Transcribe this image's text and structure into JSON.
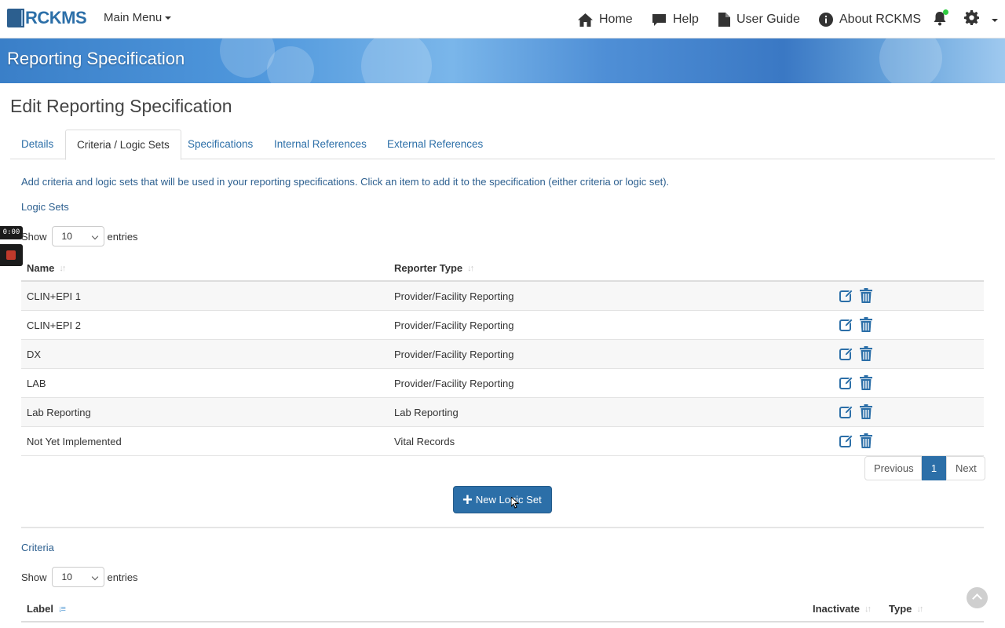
{
  "navbar": {
    "brand": "RCKMS",
    "main_menu": "Main Menu",
    "items": [
      {
        "label": "Home",
        "icon": "home-icon"
      },
      {
        "label": "Help",
        "icon": "comment-icon"
      },
      {
        "label": "User Guide",
        "icon": "document-icon"
      },
      {
        "label": "About RCKMS",
        "icon": "info-icon"
      }
    ],
    "notification_icon": "bell-icon",
    "settings_icon": "gear-icon"
  },
  "banner": {
    "title": "Reporting Specification"
  },
  "page": {
    "title": "Edit Reporting Specification"
  },
  "tabs": [
    {
      "label": "Details",
      "active": false
    },
    {
      "label": "Criteria / Logic Sets",
      "active": true
    },
    {
      "label": "Specifications",
      "active": false
    },
    {
      "label": "Internal References",
      "active": false
    },
    {
      "label": "External References",
      "active": false
    }
  ],
  "intro_text": "Add criteria and logic sets that will be used in your reporting specifications. Click an item to add it to the specification (either criteria or logic set).",
  "recorder": {
    "time": "0:00"
  },
  "logic_sets": {
    "label": "Logic Sets",
    "show_label": "Show",
    "page_size": "10",
    "entries_label": "entries",
    "columns": [
      "Name",
      "Reporter Type"
    ],
    "rows": [
      {
        "name": "CLIN+EPI 1",
        "reporter_type": "Provider/Facility Reporting"
      },
      {
        "name": "CLIN+EPI 2",
        "reporter_type": "Provider/Facility Reporting"
      },
      {
        "name": "DX",
        "reporter_type": "Provider/Facility Reporting"
      },
      {
        "name": "LAB",
        "reporter_type": "Provider/Facility Reporting"
      },
      {
        "name": "Lab Reporting",
        "reporter_type": "Lab Reporting"
      },
      {
        "name": "Not Yet Implemented",
        "reporter_type": "Vital Records"
      }
    ],
    "pagination": {
      "previous": "Previous",
      "current": "1",
      "next": "Next"
    },
    "new_button": "New Logic Set"
  },
  "criteria": {
    "label": "Criteria",
    "show_label": "Show",
    "page_size": "10",
    "entries_label": "entries",
    "columns": [
      "Label",
      "Inactivate",
      "Type"
    ]
  },
  "colors": {
    "primary": "#2c6fa8",
    "link": "#2c5f8f",
    "banner": "#4f97dc"
  }
}
